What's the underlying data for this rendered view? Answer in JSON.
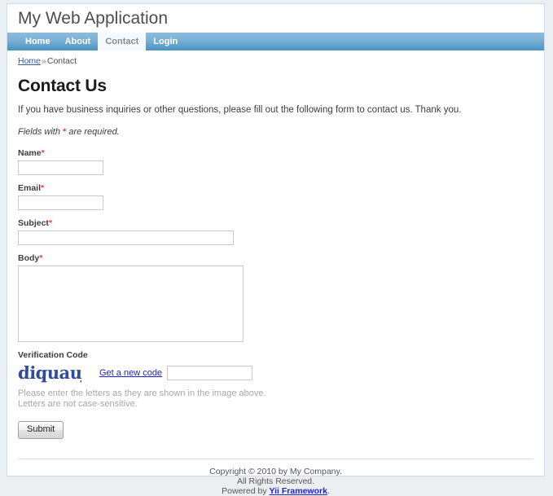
{
  "header": {
    "site_title": "My Web Application"
  },
  "nav": {
    "items": [
      {
        "label": "Home",
        "active": false
      },
      {
        "label": "About",
        "active": false
      },
      {
        "label": "Contact",
        "active": true
      },
      {
        "label": "Login",
        "active": false
      }
    ]
  },
  "breadcrumbs": {
    "home_label": "Home",
    "separator": "»",
    "current_label": "Contact"
  },
  "content": {
    "page_title": "Contact Us",
    "intro": "If you have business inquiries or other questions, please fill out the following form to contact us. Thank you.",
    "note_prefix": "Fields with ",
    "note_star": "*",
    "note_suffix": " are required."
  },
  "form": {
    "name": {
      "label": "Name",
      "required_marker": "*",
      "value": "",
      "placeholder": ""
    },
    "email": {
      "label": "Email",
      "required_marker": "*",
      "value": "",
      "placeholder": ""
    },
    "subject": {
      "label": "Subject",
      "required_marker": "*",
      "value": "",
      "placeholder": ""
    },
    "body": {
      "label": "Body",
      "required_marker": "*",
      "value": "",
      "placeholder": ""
    },
    "verification": {
      "label": "Verification Code",
      "captcha_text": "diquauj",
      "captcha_color": "#2f4b9b",
      "new_code_link": "Get a new code",
      "value": "",
      "placeholder": "",
      "hint_line1": "Please enter the letters as they are shown in the image above.",
      "hint_line2": "Letters are not case-sensitive."
    },
    "submit_label": "Submit"
  },
  "footer": {
    "line1": "Copyright © 2010 by My Company.",
    "line2": "All Rights Reserved.",
    "powered_prefix": "Powered by ",
    "powered_link": "Yii Framework",
    "powered_suffix": "."
  },
  "colors": {
    "nav_blue": "#7bb2d6",
    "link_blue": "#2222cc",
    "required_red": "#ff3b30",
    "page_bg": "#eceff1"
  }
}
